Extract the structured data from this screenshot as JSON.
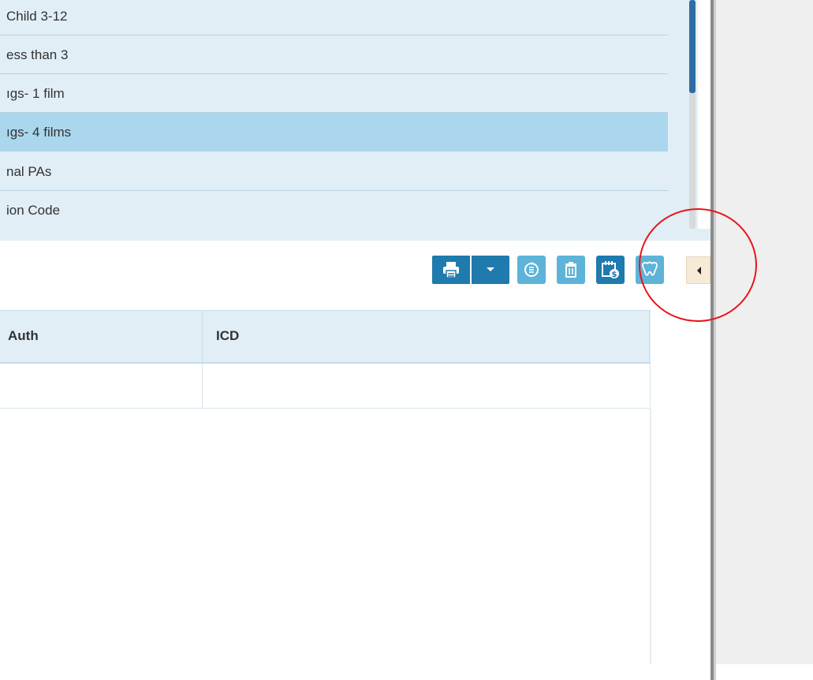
{
  "procedure_list": {
    "items": [
      {
        "label": " Child 3-12",
        "selected": false
      },
      {
        "label": "ess than 3",
        "selected": false
      },
      {
        "label": "ıgs- 1 film",
        "selected": false
      },
      {
        "label": "ıgs- 4 films",
        "selected": true
      },
      {
        "label": "nal PAs",
        "selected": false
      },
      {
        "label": "ion Code",
        "selected": false
      }
    ]
  },
  "toolbar": {
    "buttons": [
      {
        "name": "print-button",
        "icon": "printer-icon"
      },
      {
        "name": "print-options-dropdown",
        "icon": "caret-down-icon"
      },
      {
        "name": "refresh-list-button",
        "icon": "refresh-list-icon"
      },
      {
        "name": "delete-button",
        "icon": "trash-icon"
      },
      {
        "name": "fee-schedule-button",
        "icon": "calendar-dollar-icon"
      },
      {
        "name": "tooth-chart-button",
        "icon": "tooth-icon"
      },
      {
        "name": "collapse-panel-button",
        "icon": "caret-left-icon"
      }
    ]
  },
  "grid": {
    "columns": [
      "Auth",
      "ICD"
    ],
    "rows": [
      {
        "auth": "",
        "icd": ""
      }
    ]
  },
  "colors": {
    "accent": "#1f7aad",
    "accent_light": "#5db3d8",
    "list_bg": "#e1eef6",
    "selected_row": "#abd7ee",
    "annotation": "#e8141b"
  }
}
